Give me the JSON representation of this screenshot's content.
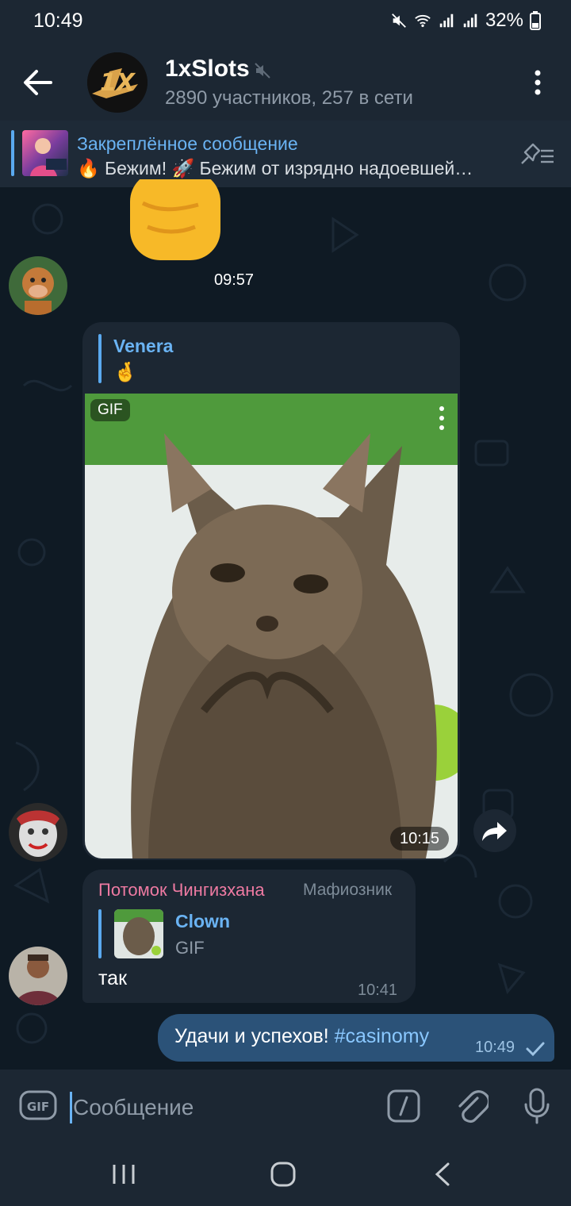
{
  "status_bar": {
    "time": "10:49",
    "battery": "32%"
  },
  "header": {
    "title": "1xSlots",
    "subtitle": "2890 участников, 257 в сети",
    "avatar_text": "1X"
  },
  "pinned": {
    "title": "Закреплённое сообщение",
    "text": "🔥 Бежим! 🚀 Бежим от изрядно надоевшей…"
  },
  "messages": {
    "m1": {
      "emoji": "✊",
      "time": "09:57"
    },
    "m2": {
      "reply_name": "Venera",
      "reply_emoji": "🤞",
      "media_badge": "GIF",
      "time": "10:15"
    },
    "m3": {
      "sender": "Потомок Чингизхана",
      "rank": "Мафиозник",
      "reply_name": "Clown",
      "reply_sub": "GIF",
      "text": "так",
      "time": "10:41"
    },
    "m4": {
      "text": "Удачи и успехов! ",
      "hashtag": "#casinomy",
      "time": "10:49"
    }
  },
  "composer": {
    "placeholder": "Сообщение",
    "gif_label": "GIF"
  },
  "colors": {
    "accent": "#6ab3f3",
    "bubble_in": "#1c2733",
    "bubble_out": "#2b5278",
    "sender_name": "#ee7aa2"
  },
  "icons": [
    "back-arrow-icon",
    "mute-icon",
    "more-vert-icon",
    "pin-list-icon",
    "forward-icon",
    "check-icon",
    "gif-icon",
    "slash-command-icon",
    "paperclip-icon",
    "microphone-icon"
  ]
}
